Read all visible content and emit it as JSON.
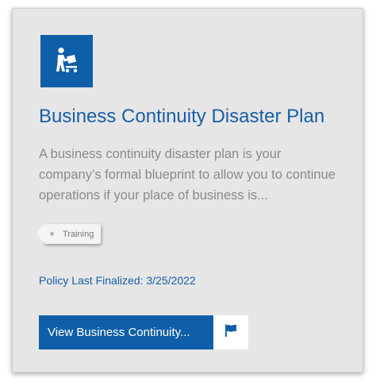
{
  "card": {
    "icon": "worker-with-box-icon",
    "title": "Business Continuity Disaster Plan",
    "description": "A business continuity disaster plan is your company’s formal blueprint to allow you to continue operations if your place of business is...",
    "tag": "Training",
    "finalized": "Policy Last Finalized: 3/25/2022",
    "view_button": "View Business Continuity...",
    "flag_icon": "flag-icon"
  },
  "colors": {
    "accent": "#0f5fa8",
    "card_background": "#e6e6e6",
    "description_text": "#8a8a8a"
  }
}
